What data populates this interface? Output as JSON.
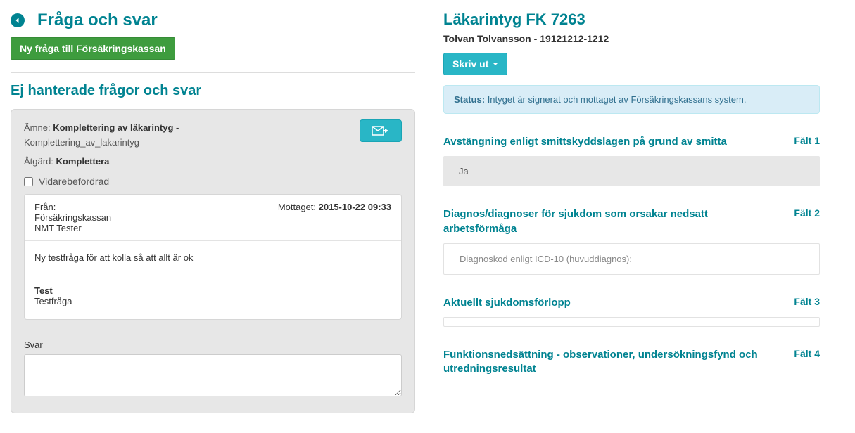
{
  "left": {
    "title": "Fråga och svar",
    "new_question_btn": "Ny fråga till Försäkringskassan",
    "unhandled_heading": "Ej hanterade frågor och svar",
    "card": {
      "subject_label": "Ämne:",
      "subject_value": "Komplettering av läkarintyg -",
      "subject_sub": "Komplettering_av_lakarintyg",
      "action_label": "Åtgärd:",
      "action_value": "Komplettera",
      "forwarded_label": "Vidarebefordrad",
      "msg": {
        "from_label": "Från:",
        "from_value": "Försäkringskassan",
        "from_sub": "NMT Tester",
        "received_label": "Mottaget:",
        "received_value": "2015-10-22 09:33",
        "body_line1": "Ny testfråga för att kolla så att allt är ok",
        "body_bold": "Test",
        "body_line2": "Testfråga"
      },
      "reply_label": "Svar"
    }
  },
  "right": {
    "cert_title": "Läkarintyg FK 7263",
    "patient": "Tolvan Tolvansson - 19121212-1212",
    "print_btn": "Skriv ut",
    "status_label": "Status:",
    "status_text": "Intyget är signerat och mottaget av Försäkringskassans system.",
    "sections": [
      {
        "title": "Avstängning enligt smittskyddslagen på grund av smitta",
        "field": "Fält 1",
        "body": "Ja",
        "style": "grey"
      },
      {
        "title": "Diagnos/diagnoser för sjukdom som orsakar nedsatt arbetsförmåga",
        "field": "Fält 2",
        "body": "Diagnoskod enligt ICD-10 (huvuddiagnos):",
        "style": "white"
      },
      {
        "title": "Aktuellt sjukdomsförlopp",
        "field": "Fält 3",
        "body": "",
        "style": "empty"
      },
      {
        "title": "Funktionsnedsättning - observationer, undersökningsfynd och utredningsresultat",
        "field": "Fält 4",
        "body": "",
        "style": "none"
      }
    ]
  }
}
